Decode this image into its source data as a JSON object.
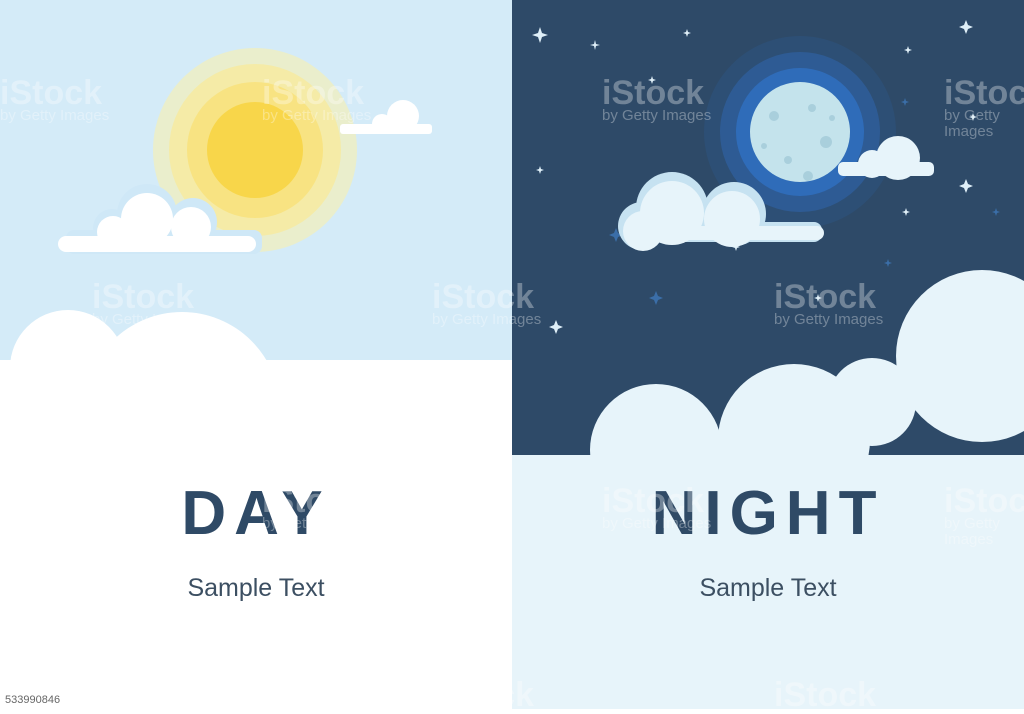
{
  "day_panel": {
    "title": "DAY",
    "subtitle": "Sample Text",
    "sky_color": "#d4ebf8",
    "sun_color": "#f8d64a",
    "cloud_color": "#ffffff"
  },
  "night_panel": {
    "title": "NIGHT",
    "subtitle": "Sample Text",
    "sky_color": "#2e4a68",
    "moon_color": "#c4e3ec",
    "glow_color": "#2f6fc4",
    "cloud_color": "#e7f4fa"
  },
  "watermark": {
    "brand": "iStock",
    "byline": "by Getty Images"
  },
  "image_id": "533990846"
}
